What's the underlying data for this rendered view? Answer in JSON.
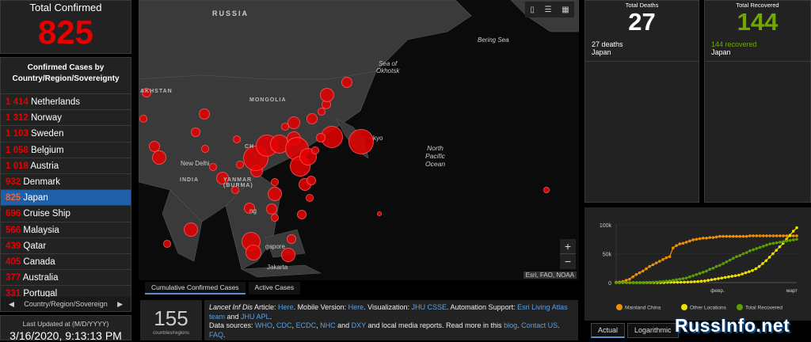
{
  "total_confirmed": {
    "label": "Total Confirmed",
    "value": "825"
  },
  "case_list": {
    "header": "Confirmed Cases by Country/Region/Sovereignty",
    "rows": [
      {
        "n": "1 414",
        "name": "Netherlands"
      },
      {
        "n": "1 312",
        "name": "Norway"
      },
      {
        "n": "1 103",
        "name": "Sweden"
      },
      {
        "n": "1 058",
        "name": "Belgium"
      },
      {
        "n": "1 018",
        "name": "Austria"
      },
      {
        "n": "932",
        "name": "Denmark"
      },
      {
        "n": "825",
        "name": "Japan"
      },
      {
        "n": "696",
        "name": "Cruise Ship"
      },
      {
        "n": "566",
        "name": "Malaysia"
      },
      {
        "n": "439",
        "name": "Qatar"
      },
      {
        "n": "405",
        "name": "Canada"
      },
      {
        "n": "377",
        "name": "Australia"
      },
      {
        "n": "331",
        "name": "Portugal"
      }
    ],
    "nav_label": "Country/Region/Sovereign"
  },
  "updated": {
    "label": "Last Updated at (M/D/YYYY)",
    "value": "3/16/2020, 9:13:13 PM"
  },
  "map": {
    "labels": {
      "russia": "RUSSIA",
      "mongolia": "MONGOLIA",
      "kazakhstan": "AKHSTAN",
      "india": "INDIA",
      "myanmar": "YANMAR\n(BURMA)",
      "new_delhi": "New Delhi",
      "bering": "Bering Sea",
      "okhotsk": "Sea of\nOkhotsk",
      "pacific": "North\nPacific\nOcean",
      "jakarta": "Jakarta",
      "singapore": "gapore",
      "tokyo": "kyo",
      "ch": "CH",
      "ng": "ng"
    },
    "attribution": "Esri, FAO, NOAA",
    "zoom_in": "+",
    "zoom_out": "−"
  },
  "map_tabs": [
    "Cumulative Confirmed Cases",
    "Active Cases"
  ],
  "count": {
    "value": "155",
    "label": "countries/regions"
  },
  "info": {
    "p1": "Lancet Inf Dis",
    "p2": " Article: ",
    "l1": "Here",
    "p3": ". Mobile Version: ",
    "l2": "Here",
    "p4": ". Visualization: ",
    "l3": "JHU CSSE",
    "p5": ". Automation Support: ",
    "l4": "Esri Living Atlas team",
    "p6": " and ",
    "l5": "JHU APL",
    "p7": ".",
    "p8": "Data sources: ",
    "l6": "WHO",
    "l7": "CDC",
    "l8": "ECDC",
    "l9": "NHC",
    "l10": "DXY",
    "p9": " and local media reports. Read more in this ",
    "l11": "blog",
    "l12": "Contact US",
    "l13": "FAQ",
    "c": ", ",
    "a": " and ",
    "dot": ". ",
    "end": "."
  },
  "deaths": {
    "label": "Total Deaths",
    "value": "27",
    "sub": "27 deaths",
    "loc": "Japan"
  },
  "recovered": {
    "label": "Total Recovered",
    "value": "144",
    "sub": "144 recovered",
    "loc": "Japan",
    "color": "#70a800"
  },
  "chart_data": {
    "type": "line",
    "y_ticks": [
      "100k",
      "50k",
      "0"
    ],
    "x_ticks": [
      "февр.",
      "март"
    ],
    "legend": [
      "Mainland China",
      "Other Locations",
      "Total Recovered"
    ],
    "colors": [
      "#f09000",
      "#f0e000",
      "#5aa000"
    ],
    "series": [
      {
        "name": "Mainland China",
        "values": [
          0.6,
          1,
          2,
          4,
          6,
          10,
          14,
          17,
          20,
          24,
          28,
          31,
          34,
          37,
          40,
          43,
          45,
          60,
          64,
          67,
          68,
          70,
          72,
          74,
          75,
          76,
          77,
          77,
          78,
          78,
          79,
          80,
          80,
          80,
          80,
          80,
          80,
          80,
          80,
          80,
          81,
          81,
          81,
          81,
          81,
          81,
          81,
          81,
          81,
          81,
          81,
          81,
          81,
          81,
          81
        ]
      },
      {
        "name": "Other Locations",
        "values": [
          0,
          0,
          0,
          0,
          0,
          0,
          0,
          0,
          0,
          0,
          0,
          0,
          0,
          0,
          0,
          0.5,
          0.5,
          0.6,
          0.6,
          0.7,
          0.8,
          1,
          1.2,
          1.5,
          2,
          2.5,
          3,
          4,
          5,
          6,
          7,
          8,
          9,
          10,
          11,
          12,
          13,
          15,
          17,
          19,
          21,
          24,
          28,
          33,
          38,
          44,
          50,
          56,
          62,
          68,
          75,
          82,
          89,
          95
        ]
      },
      {
        "name": "Total Recovered",
        "values": [
          0,
          0,
          0,
          0,
          0,
          0,
          0,
          0,
          0,
          0.2,
          0.4,
          0.6,
          1,
          1.5,
          2,
          2.5,
          3,
          4,
          5,
          6,
          7,
          8,
          10,
          12,
          14,
          16,
          18,
          20,
          23,
          25,
          28,
          30,
          33,
          36,
          39,
          42,
          45,
          47,
          50,
          52,
          55,
          57,
          59,
          61,
          63,
          65,
          67,
          68,
          69,
          70,
          71,
          72,
          73,
          74,
          75
        ]
      }
    ]
  },
  "chart_tabs": [
    "Actual",
    "Logarithmic"
  ],
  "watermark": "RussInfo.net"
}
